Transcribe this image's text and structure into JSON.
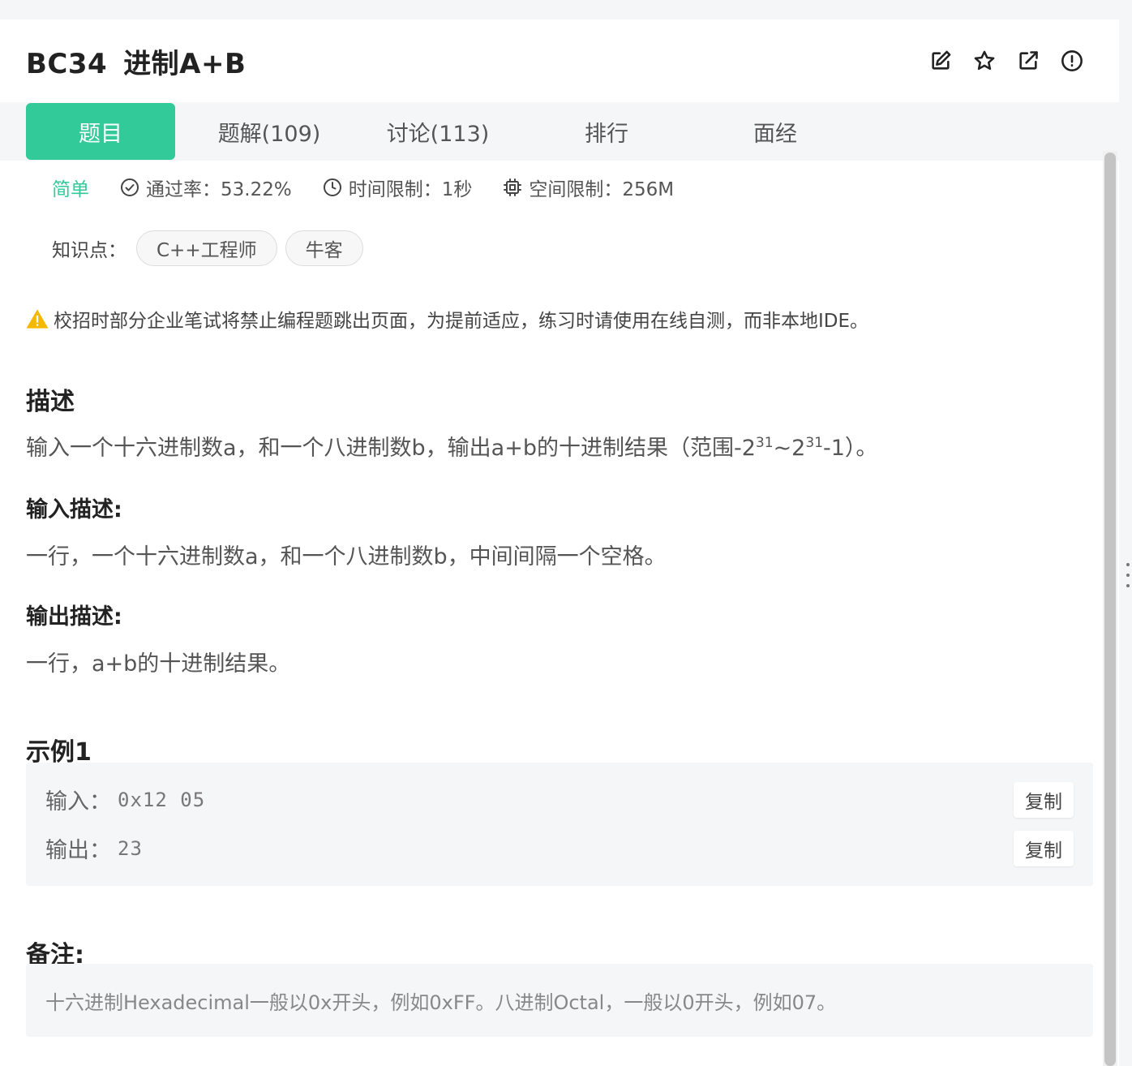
{
  "problem": {
    "id": "BC34",
    "title": "进制A+B"
  },
  "header_icons": [
    "edit-icon",
    "star-icon",
    "share-icon",
    "report-icon"
  ],
  "tabs": [
    {
      "label": "题目",
      "active": true
    },
    {
      "label": "题解(109)"
    },
    {
      "label": "讨论(113)"
    },
    {
      "label": "排行"
    },
    {
      "label": "面经"
    }
  ],
  "meta": {
    "difficulty": "简单",
    "pass_rate": "通过率：53.22%",
    "time_limit": "时间限制：1秒",
    "memory_limit": "空间限制：256M"
  },
  "knowledge": {
    "label": "知识点：",
    "tags": [
      "C++工程师",
      "牛客"
    ]
  },
  "warning": "校招时部分企业笔试将禁止编程题跳出页面，为提前适应，练习时请使用在线自测，而非本地IDE。",
  "description": {
    "title": "描述",
    "text_prefix": "输入一个十六进制数a，和一个八进制数b，输出a+b的十进制结果（范围-2",
    "sup1": "31",
    "text_mid": "~2",
    "sup2": "31",
    "text_suffix": "-1）。"
  },
  "input_desc": {
    "title": "输入描述:",
    "text": "一行，一个十六进制数a，和一个八进制数b，中间间隔一个空格。"
  },
  "output_desc": {
    "title": "输出描述:",
    "text": "一行，a+b的十进制结果。"
  },
  "example": {
    "title": "示例1",
    "input_label": "输入：",
    "input_value": "0x12 05",
    "output_label": "输出：",
    "output_value": "23",
    "copy_label": "复制"
  },
  "remark": {
    "title": "备注:",
    "text": "十六进制Hexadecimal一般以0x开头，例如0xFF。八进制Octal，一般以0开头，例如07。"
  },
  "colors": {
    "accent": "#32ca99",
    "warning": "#f5b800"
  }
}
